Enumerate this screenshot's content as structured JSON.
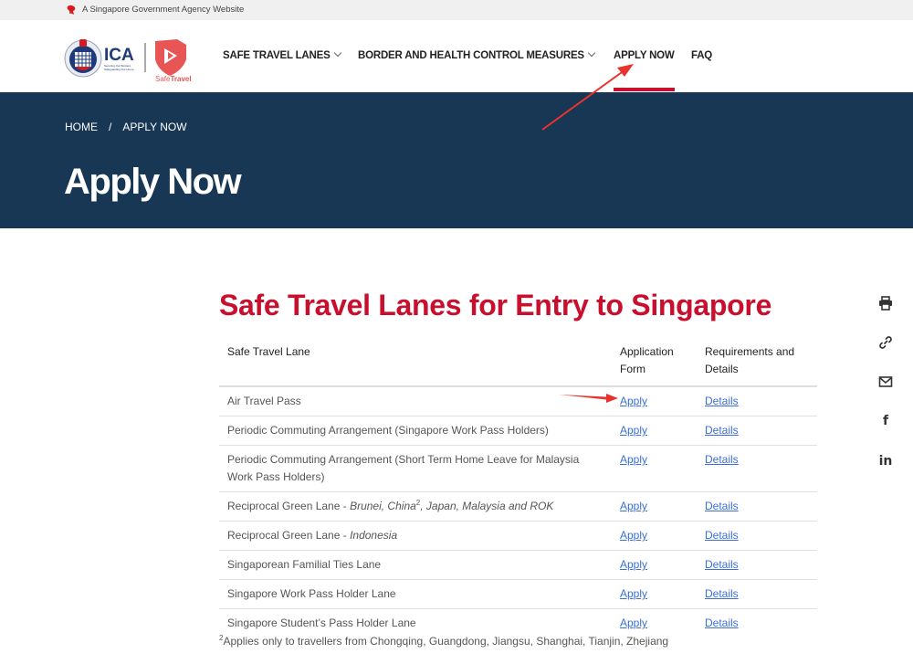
{
  "gov_banner": {
    "text": "A Singapore Government Agency Website",
    "icon": "lion-head-icon"
  },
  "header": {
    "logo": {
      "agency": "ICA",
      "tagline": "Securing Our Borders, Safeguarding Our Home",
      "product": "SafeTravel"
    },
    "nav": [
      {
        "label": "SAFE TRAVEL LANES",
        "has_dropdown": true
      },
      {
        "label": "BORDER AND HEALTH CONTROL MEASURES",
        "has_dropdown": true
      },
      {
        "label": "APPLY NOW",
        "has_dropdown": false,
        "active": true
      },
      {
        "label": "FAQ",
        "has_dropdown": false
      }
    ]
  },
  "hero": {
    "breadcrumb": [
      "HOME",
      "APPLY NOW"
    ],
    "breadcrumb_separator": "/",
    "title": "Apply Now"
  },
  "content": {
    "title": "Safe Travel Lanes for Entry to Singapore",
    "table": {
      "headers": [
        "Safe Travel Lane",
        "Application Form",
        "Requirements and Details"
      ],
      "rows": [
        {
          "lane": "Air Travel Pass",
          "lane_italic": "",
          "apply": "Apply",
          "details": "Details"
        },
        {
          "lane": "Periodic Commuting Arrangement (Singapore Work Pass Holders)",
          "lane_italic": "",
          "apply": "Apply",
          "details": "Details"
        },
        {
          "lane": "Periodic Commuting Arrangement (Short Term Home Leave for Malaysia Work Pass Holders)",
          "lane_italic": "",
          "apply": "Apply",
          "details": "Details"
        },
        {
          "lane": "Reciprocal Green Lane - ",
          "lane_italic": "Brunei, China",
          "lane_sup": "2",
          "lane_italic_after": ", Japan, Malaysia and ROK",
          "apply": "Apply",
          "details": "Details"
        },
        {
          "lane": "Reciprocal Green Lane - ",
          "lane_italic": "Indonesia",
          "apply": "Apply",
          "details": "Details"
        },
        {
          "lane": "Singaporean Familial Ties Lane",
          "lane_italic": "",
          "apply": "Apply",
          "details": "Details"
        },
        {
          "lane": "Singapore Work Pass Holder Lane",
          "lane_italic": "",
          "apply": "Apply",
          "details": "Details"
        },
        {
          "lane": "Singapore Student’s Pass Holder Lane",
          "lane_italic": "",
          "apply": "Apply",
          "details": "Details"
        }
      ]
    },
    "footnote": {
      "marker": "2",
      "text": "Applies only to travellers from Chongqing, Guangdong, Jiangsu, Shanghai, Tianjin, Zhejiang"
    }
  },
  "share": [
    {
      "icon": "print-icon",
      "glyph": ""
    },
    {
      "icon": "link-icon",
      "glyph": ""
    },
    {
      "icon": "email-icon",
      "glyph": ""
    },
    {
      "icon": "facebook-icon",
      "glyph": "f"
    },
    {
      "icon": "linkedin-icon",
      "glyph": "in"
    }
  ],
  "colors": {
    "accent_red": "#c8102e",
    "hero_navy": "#173755",
    "link_blue": "#3a6fd8",
    "annotation_red": "#e8322e"
  }
}
